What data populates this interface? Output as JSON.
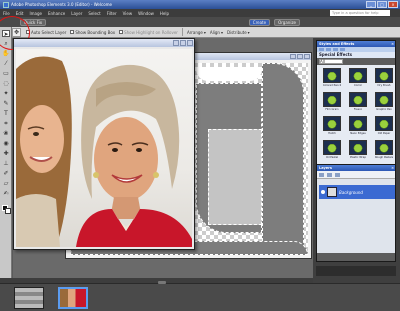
{
  "app": {
    "title": "Adobe Photoshop Elements 3.0 (Editor) - Welcome",
    "help_search_placeholder": "Type in a question for help",
    "menu": [
      "File",
      "Edit",
      "Image",
      "Enhance",
      "Layer",
      "Select",
      "Filter",
      "View",
      "Window",
      "Help"
    ]
  },
  "topbar": {
    "quick_fix": "Quick Fix",
    "create": "Create",
    "organize": "Organize"
  },
  "options": {
    "auto_select_layer": "Auto Select Layer",
    "show_bounding_box": "Show Bounding Box",
    "show_highlight": "Show Highlight on Rollover",
    "arrange": "Arrange",
    "align": "Align",
    "distribute": "Distribute"
  },
  "panels": {
    "effects": {
      "title": "Styles and Effects",
      "section": "Special Effects",
      "dropdown": "All",
      "items": [
        "Colored Pencil",
        "Comic",
        "Dry Brush",
        "Film Grain",
        "Fresco",
        "Graphic Pen",
        "Hatch",
        "Neon Edges",
        "Old Paper",
        "Oil Pastel",
        "Plastic Wrap",
        "Rough Pastels"
      ]
    },
    "layers": {
      "title": "Layers",
      "layer_name": "Background"
    }
  },
  "colors": {
    "accent": "#2c57b3",
    "annotation": "#e01515"
  }
}
